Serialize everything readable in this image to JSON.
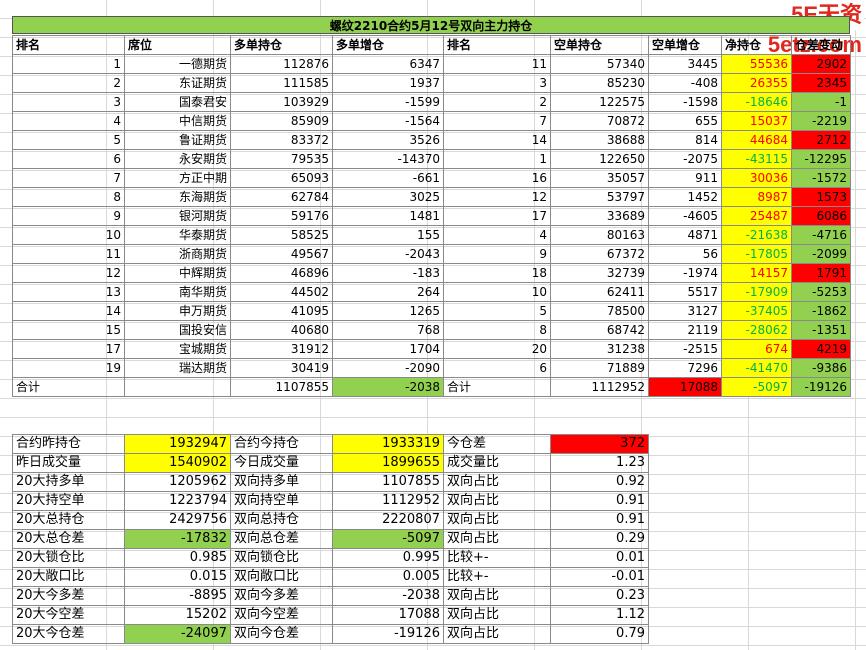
{
  "watermark": "5E天资5etz.com",
  "title": "螺纹2210合约5月12号双向主力持仓",
  "headers": [
    "排名",
    "席位",
    "多单持仓",
    "多单增仓",
    "排名",
    "空单持仓",
    "空单增仓",
    "净持仓",
    "仓差变动"
  ],
  "rows": [
    {
      "rank": "1",
      "seat": "一德期货",
      "long": "112876",
      "long_chg": "6347",
      "srank": "11",
      "short": "57340",
      "short_chg": "3445",
      "net": "55536",
      "net_color": "yellow",
      "diff": "2902",
      "diff_color": "red"
    },
    {
      "rank": "2",
      "seat": "东证期货",
      "long": "111585",
      "long_chg": "1937",
      "srank": "3",
      "short": "85230",
      "short_chg": "-408",
      "net": "26355",
      "net_color": "yellow",
      "diff": "2345",
      "diff_color": "red"
    },
    {
      "rank": "3",
      "seat": "国泰君安",
      "long": "103929",
      "long_chg": "-1599",
      "srank": "2",
      "short": "122575",
      "short_chg": "-1598",
      "net": "-18646",
      "net_color": "yellow",
      "diff": "-1",
      "diff_color": "green"
    },
    {
      "rank": "4",
      "seat": "中信期货",
      "long": "85909",
      "long_chg": "-1564",
      "srank": "7",
      "short": "70872",
      "short_chg": "655",
      "net": "15037",
      "net_color": "yellow",
      "diff": "-2219",
      "diff_color": "green"
    },
    {
      "rank": "5",
      "seat": "鲁证期货",
      "long": "83372",
      "long_chg": "3526",
      "srank": "14",
      "short": "38688",
      "short_chg": "814",
      "net": "44684",
      "net_color": "yellow",
      "diff": "2712",
      "diff_color": "red"
    },
    {
      "rank": "6",
      "seat": "永安期货",
      "long": "79535",
      "long_chg": "-14370",
      "srank": "1",
      "short": "122650",
      "short_chg": "-2075",
      "net": "-43115",
      "net_color": "yellow",
      "diff": "-12295",
      "diff_color": "green"
    },
    {
      "rank": "7",
      "seat": "方正中期",
      "long": "65093",
      "long_chg": "-661",
      "srank": "16",
      "short": "35057",
      "short_chg": "911",
      "net": "30036",
      "net_color": "yellow",
      "diff": "-1572",
      "diff_color": "green"
    },
    {
      "rank": "8",
      "seat": "东海期货",
      "long": "62784",
      "long_chg": "3025",
      "srank": "12",
      "short": "53797",
      "short_chg": "1452",
      "net": "8987",
      "net_color": "yellow",
      "diff": "1573",
      "diff_color": "red"
    },
    {
      "rank": "9",
      "seat": "银河期货",
      "long": "59176",
      "long_chg": "1481",
      "srank": "17",
      "short": "33689",
      "short_chg": "-4605",
      "net": "25487",
      "net_color": "yellow",
      "diff": "6086",
      "diff_color": "red"
    },
    {
      "rank": "10",
      "seat": "华泰期货",
      "long": "58525",
      "long_chg": "155",
      "srank": "4",
      "short": "80163",
      "short_chg": "4871",
      "net": "-21638",
      "net_color": "yellow",
      "diff": "-4716",
      "diff_color": "green"
    },
    {
      "rank": "11",
      "seat": "浙商期货",
      "long": "49567",
      "long_chg": "-2043",
      "srank": "9",
      "short": "67372",
      "short_chg": "56",
      "net": "-17805",
      "net_color": "yellow",
      "diff": "-2099",
      "diff_color": "green"
    },
    {
      "rank": "12",
      "seat": "中辉期货",
      "long": "46896",
      "long_chg": "-183",
      "srank": "18",
      "short": "32739",
      "short_chg": "-1974",
      "net": "14157",
      "net_color": "yellow",
      "diff": "1791",
      "diff_color": "red"
    },
    {
      "rank": "13",
      "seat": "南华期货",
      "long": "44502",
      "long_chg": "264",
      "srank": "10",
      "short": "62411",
      "short_chg": "5517",
      "net": "-17909",
      "net_color": "yellow",
      "diff": "-5253",
      "diff_color": "green"
    },
    {
      "rank": "14",
      "seat": "申万期货",
      "long": "41095",
      "long_chg": "1265",
      "srank": "5",
      "short": "78500",
      "short_chg": "3127",
      "net": "-37405",
      "net_color": "yellow",
      "diff": "-1862",
      "diff_color": "green"
    },
    {
      "rank": "15",
      "seat": "国投安信",
      "long": "40680",
      "long_chg": "768",
      "srank": "8",
      "short": "68742",
      "short_chg": "2119",
      "net": "-28062",
      "net_color": "yellow",
      "diff": "-1351",
      "diff_color": "green"
    },
    {
      "rank": "17",
      "seat": "宝城期货",
      "long": "31912",
      "long_chg": "1704",
      "srank": "20",
      "short": "31238",
      "short_chg": "-2515",
      "net": "674",
      "net_color": "yellow",
      "diff": "4219",
      "diff_color": "red"
    },
    {
      "rank": "19",
      "seat": "瑞达期货",
      "long": "30419",
      "long_chg": "-2090",
      "srank": "6",
      "short": "71889",
      "short_chg": "7296",
      "net": "-41470",
      "net_color": "yellow",
      "diff": "-9386",
      "diff_color": "green"
    }
  ],
  "total": {
    "label": "合计",
    "long": "1107855",
    "long_chg": "-2038",
    "label2": "合计",
    "short": "1112952",
    "short_chg": "17088",
    "net": "-5097",
    "diff": "-19126"
  },
  "summary": [
    {
      "l1": "合约昨持仓",
      "v1": "1932947",
      "c1": "yellow",
      "l2": "合约今持仓",
      "v2": "1933319",
      "c2": "yellow",
      "l3": "今仓差",
      "v3": "372",
      "c3": "red"
    },
    {
      "l1": "昨日成交量",
      "v1": "1540902",
      "c1": "yellow",
      "l2": "今日成交量",
      "v2": "1899655",
      "c2": "yellow",
      "l3": "成交量比",
      "v3": "1.23",
      "c3": ""
    },
    {
      "l1": "20大持多单",
      "v1": "1205962",
      "c1": "",
      "l2": "双向持多单",
      "v2": "1107855",
      "c2": "",
      "l3": "双向占比",
      "v3": "0.92",
      "c3": ""
    },
    {
      "l1": "20大持空单",
      "v1": "1223794",
      "c1": "",
      "l2": "双向持空单",
      "v2": "1112952",
      "c2": "",
      "l3": "双向占比",
      "v3": "0.91",
      "c3": ""
    },
    {
      "l1": "20大总持仓",
      "v1": "2429756",
      "c1": "",
      "l2": "双向总持仓",
      "v2": "2220807",
      "c2": "",
      "l3": "双向占比",
      "v3": "0.91",
      "c3": ""
    },
    {
      "l1": "20大总仓差",
      "v1": "-17832",
      "c1": "green",
      "l2": "双向总仓差",
      "v2": "-5097",
      "c2": "green",
      "l3": "双向占比",
      "v3": "0.29",
      "c3": ""
    },
    {
      "l1": "20大锁仓比",
      "v1": "0.985",
      "c1": "",
      "l2": "双向锁仓比",
      "v2": "0.995",
      "c2": "",
      "l3": "比较+-",
      "v3": "0.01",
      "c3": ""
    },
    {
      "l1": "20大敞口比",
      "v1": "0.015",
      "c1": "",
      "l2": "双向敞口比",
      "v2": "0.005",
      "c2": "",
      "l3": "比较+-",
      "v3": "-0.01",
      "c3": ""
    },
    {
      "l1": "20大今多差",
      "v1": "-8895",
      "c1": "",
      "l2": "双向今多差",
      "v2": "-2038",
      "c2": "",
      "l3": "双向占比",
      "v3": "0.23",
      "c3": ""
    },
    {
      "l1": "20大今空差",
      "v1": "15202",
      "c1": "",
      "l2": "双向今空差",
      "v2": "17088",
      "c2": "",
      "l3": "双向占比",
      "v3": "1.12",
      "c3": ""
    },
    {
      "l1": "20大今仓差",
      "v1": "-24097",
      "c1": "green",
      "l2": "双向今仓差",
      "v2": "-19126",
      "c2": "",
      "l3": "双向占比",
      "v3": "0.79",
      "c3": ""
    }
  ]
}
